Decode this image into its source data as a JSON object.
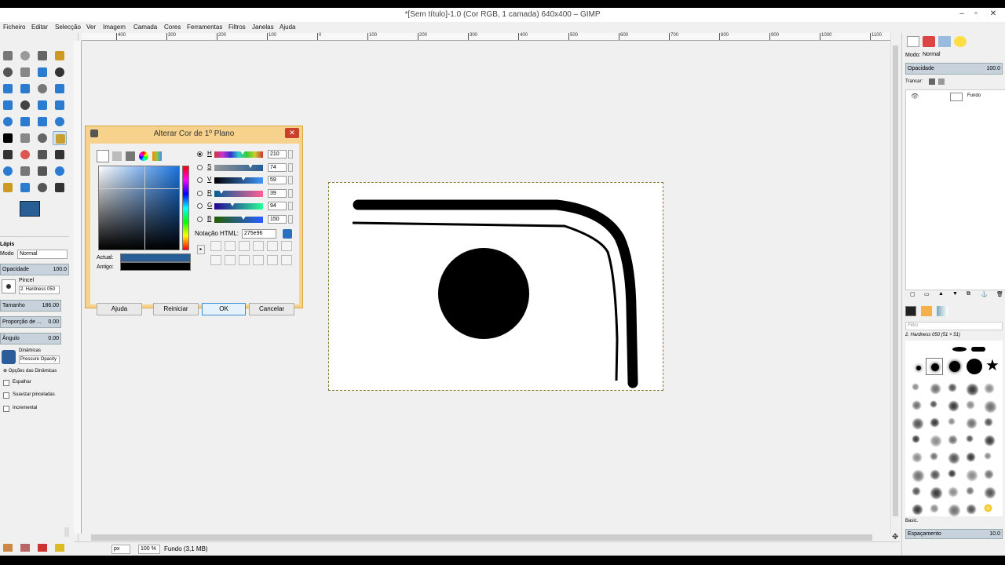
{
  "window": {
    "title": "*[Sem título]-1.0 (Cor RGB, 1 camada) 640x400 – GIMP"
  },
  "menu": [
    "Ficheiro",
    "Editar",
    "Selecção",
    "Ver",
    "Imagem",
    "Camada",
    "Cores",
    "Ferramentas",
    "Filtros",
    "Janelas",
    "Ajuda"
  ],
  "tool_options": {
    "title": "Lápis",
    "mode_label": "Modo",
    "mode_value": "Normal",
    "opacity_label": "Opacidade",
    "opacity_value": "100.0",
    "brush_label": "Pincel",
    "brush_value": "2. Hardness 050",
    "size_label": "Tamanho",
    "size_value": "186.00",
    "aspect_label": "Proporção de ...",
    "aspect_value": "0.00",
    "angle_label": "Ângulo",
    "angle_value": "0.00",
    "dynamics_label": "Dinâmicas",
    "dynamics_value": "Pressure Opacity",
    "dynamics_options": "Opções das Dinâmicas",
    "jitter": "Espalhar",
    "smooth": "Suavizar pinceladas",
    "incremental": "Incremental"
  },
  "colors": {
    "foreground": "#275e96",
    "background": "#ffffff"
  },
  "dialog": {
    "title": "Alterar Cor de 1º Plano",
    "channels": [
      {
        "label": "H",
        "value": "210",
        "level": 0.58,
        "selected": true
      },
      {
        "label": "S",
        "value": "74",
        "level": 0.74,
        "selected": false
      },
      {
        "label": "V",
        "value": "59",
        "level": 0.59,
        "selected": false
      },
      {
        "label": "R",
        "value": "39",
        "level": 0.15,
        "selected": false
      },
      {
        "label": "G",
        "value": "94",
        "level": 0.37,
        "selected": false
      },
      {
        "label": "B",
        "value": "150",
        "level": 0.59,
        "selected": false
      }
    ],
    "html_label": "Notação HTML:",
    "html_value": "275e96",
    "current_label": "Actual:",
    "old_label": "Antigo:",
    "current_color": "#275e96",
    "old_color": "#000000",
    "buttons": {
      "help": "Ajuda",
      "reset": "Reiniciar",
      "ok": "OK",
      "cancel": "Cancelar"
    }
  },
  "rulers": {
    "top": [
      "400",
      "300",
      "200",
      "100",
      "0",
      "100",
      "200",
      "300",
      "400",
      "500",
      "600",
      "700",
      "800",
      "900",
      "1000",
      "1100"
    ]
  },
  "status": {
    "unit": "px",
    "zoom": "100 %",
    "layer_info": "Fundo (3,1 MB)"
  },
  "layers": {
    "mode_label": "Modo:",
    "mode_value": "Normal",
    "opacity_label": "Opacidade",
    "opacity_value": "100.0",
    "lock_label": "Trancar:",
    "items": [
      {
        "name": "Fundo"
      }
    ]
  },
  "brushes": {
    "filter_placeholder": "Filtro",
    "selected": "2. Hardness 050 (51 × 51)",
    "tag": "Basic.",
    "spacing_label": "Espaçamento",
    "spacing_value": "10.0"
  }
}
